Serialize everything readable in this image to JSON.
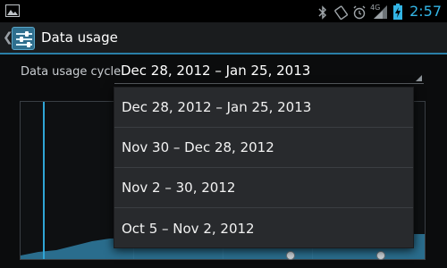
{
  "status_bar": {
    "time": "2:57",
    "network_label": "4G",
    "icons": [
      "image-notification-icon",
      "bluetooth-icon",
      "screen-rotation-icon",
      "alarm-icon",
      "signal-icon",
      "battery-charging-icon"
    ]
  },
  "action_bar": {
    "title": "Data usage",
    "icon": "data-usage-app-icon"
  },
  "cycle": {
    "label": "Data usage cycle",
    "selected": "Dec 28, 2012 – Jan 25, 2013"
  },
  "dropdown": {
    "options": [
      "Dec 28, 2012 – Jan 25, 2013",
      "Nov 30 – Dec 28, 2012",
      "Nov 2 – 30, 2012",
      "Oct 5 – Nov 2, 2012"
    ]
  },
  "colors": {
    "accent": "#33b5e5",
    "chart_fill": "#2f7ea3",
    "divider": "#2a7fa8"
  }
}
